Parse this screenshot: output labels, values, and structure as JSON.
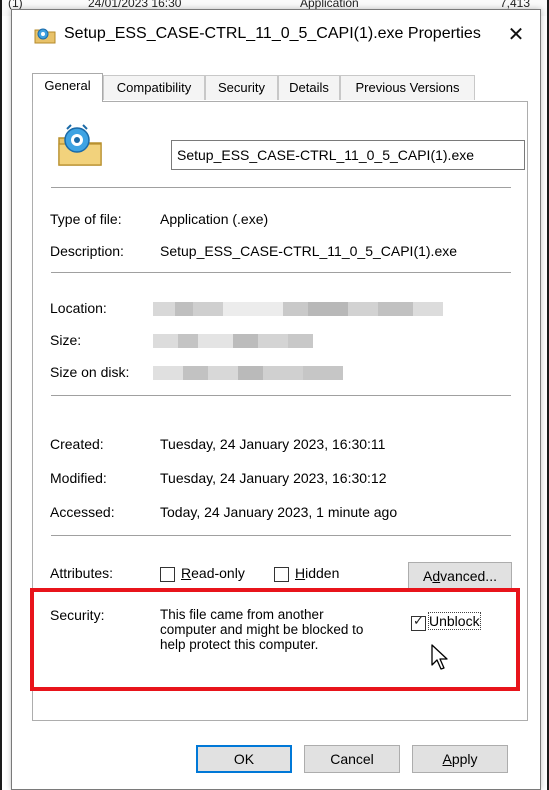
{
  "background": {
    "text_left": "(1)",
    "text_date": "24/01/2023 16:30",
    "text_type": "Application",
    "text_size": "7,413"
  },
  "window": {
    "title": "Setup_ESS_CASE-CTRL_11_0_5_CAPI(1).exe Properties",
    "close_symbol": "✕"
  },
  "tabs": [
    {
      "label": "General"
    },
    {
      "label": "Compatibility"
    },
    {
      "label": "Security"
    },
    {
      "label": "Details"
    },
    {
      "label": "Previous Versions"
    }
  ],
  "general": {
    "file_name": "Setup_ESS_CASE-CTRL_11_0_5_CAPI(1).exe",
    "type_label": "Type of file:",
    "type_value": "Application (.exe)",
    "description_label": "Description:",
    "description_value": "Setup_ESS_CASE-CTRL_11_0_5_CAPI(1).exe",
    "location_label": "Location:",
    "size_label": "Size:",
    "size_on_disk_label": "Size on disk:",
    "created_label": "Created:",
    "created_value": "Tuesday, 24 January 2023, 16:30:11",
    "modified_label": "Modified:",
    "modified_value": "Tuesday, 24 January 2023, 16:30:12",
    "accessed_label": "Accessed:",
    "accessed_value": "Today, 24 January 2023, 1 minute ago",
    "attributes_label": "Attributes:",
    "readonly_label": "Read-only",
    "readonly_mnemonic": "R",
    "readonly_rest": "ead-only",
    "hidden_label": "Hidden",
    "hidden_mnemonic": "H",
    "hidden_rest": "idden",
    "advanced_label": "Advanced...",
    "advanced_pre": "A",
    "advanced_mnemonic": "d",
    "advanced_rest": "vanced...",
    "security_label": "Security:",
    "security_text_1": "This file came from another",
    "security_text_2": "computer and might be blocked to",
    "security_text_3": "help protect this computer.",
    "unblock_label": "Unblock",
    "unblock_checked": true
  },
  "buttons": {
    "ok": "OK",
    "cancel": "Cancel",
    "apply": "Apply",
    "apply_mnemonic": "A",
    "apply_rest": "pply"
  },
  "colors": {
    "highlight_box": "#e8141b",
    "focus_border": "#0078d7",
    "button_bg": "#e1e1e1"
  }
}
